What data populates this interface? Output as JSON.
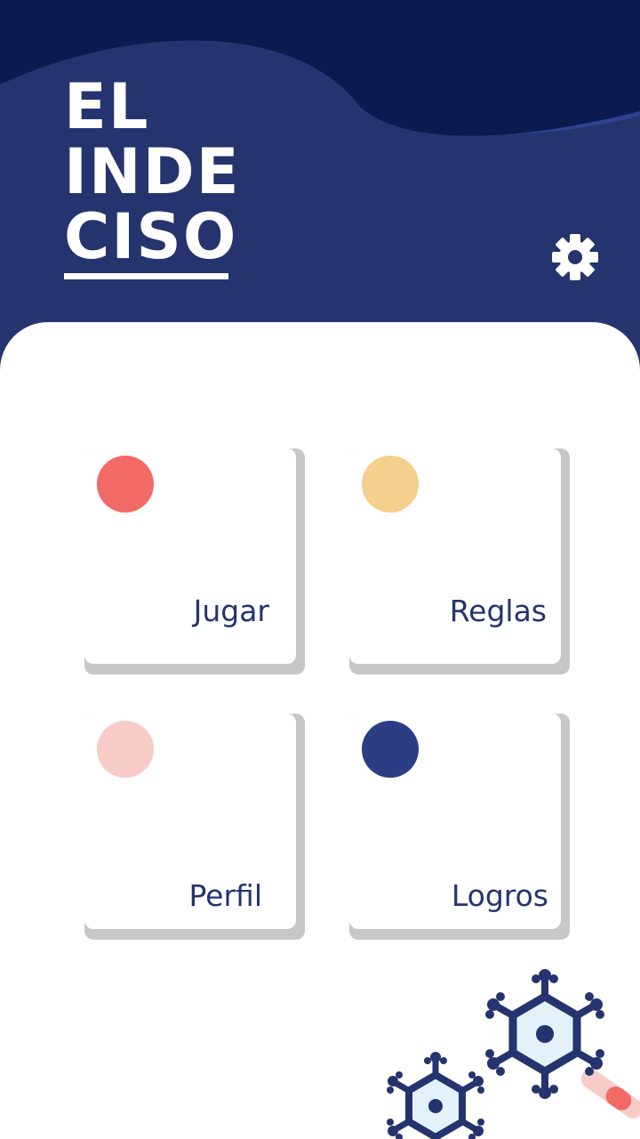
{
  "app": {
    "title_lines": [
      "EL",
      "INDE",
      "CISO"
    ],
    "settings_icon": "gear-icon"
  },
  "colors": {
    "header_bg": "#25346e",
    "header_dark": "#0b1a4f",
    "card_shadow": "#c7c7c7",
    "text": "#25346e"
  },
  "menu": {
    "items": [
      {
        "label": "Jugar",
        "dot_color": "#f26a66"
      },
      {
        "label": "Reglas",
        "dot_color": "#f5cf8e"
      },
      {
        "label": "Perfil",
        "dot_color": "#f7ccc6"
      },
      {
        "label": "Logros",
        "dot_color": "#2b3d85"
      }
    ]
  },
  "decoration": {
    "icon": "virus-cells-icon"
  }
}
